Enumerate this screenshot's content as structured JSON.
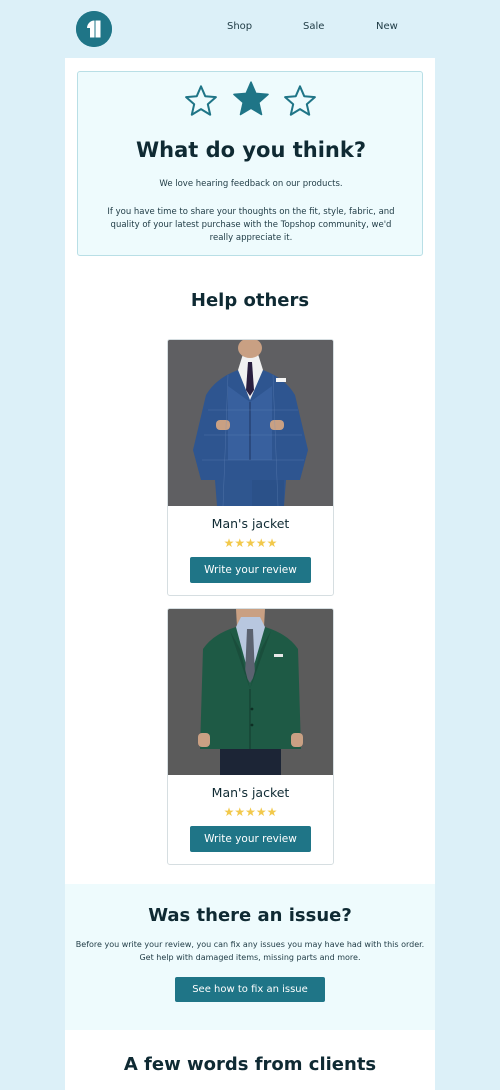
{
  "header": {
    "logo_icon": "brand-logo-icon",
    "nav": [
      "Shop",
      "Sale",
      "New"
    ]
  },
  "hero": {
    "title": "What do you think?",
    "line1": "We love hearing feedback on our products.",
    "line2": "If you have time to share your thoughts on the fit, style, fabric, and quality of your latest purchase with the Topshop community, we'd really appreciate it.",
    "star_icons": [
      "star-outline-icon",
      "star-filled-icon",
      "star-outline-icon"
    ]
  },
  "help": {
    "title": "Help others",
    "products": [
      {
        "name": "Man's jacket",
        "rating": 5,
        "stars": "★★★★★",
        "button": "Write your review"
      },
      {
        "name": "Man's jacket",
        "rating": 5,
        "stars": "★★★★★",
        "button": "Write your review"
      }
    ]
  },
  "issue": {
    "title": "Was there an issue?",
    "text": "Before you write your review, you can fix any issues you may have had with this order. Get help with damaged items, missing parts and more.",
    "button": "See how to fix an issue"
  },
  "clients": {
    "title": "A few words from clients"
  },
  "colors": {
    "page_bg": "#dcf0f8",
    "accent": "#1f7587",
    "star": "#f2c94c",
    "panel": "#eefbfd"
  }
}
